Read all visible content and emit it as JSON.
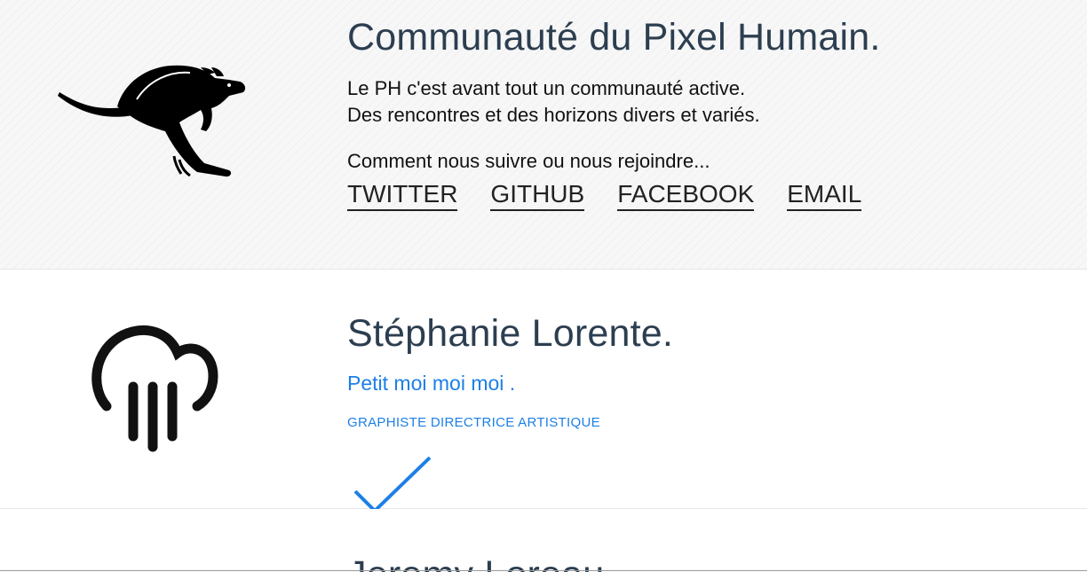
{
  "community": {
    "title": "Communauté du Pixel Humain.",
    "desc_line1": "Le PH c'est avant tout un communauté active.",
    "desc_line2": "Des rencontres et des horizons divers et variés.",
    "follow_text": "Comment nous suivre ou nous rejoindre...",
    "links": [
      "TWITTER",
      "GITHUB",
      "FACEBOOK",
      "EMAIL"
    ],
    "icon": "kangaroo-icon"
  },
  "member1": {
    "name": "Stéphanie Lorente.",
    "tagline": "Petit moi moi moi .",
    "role": "GRAPHISTE DIRECTRICE ARTISTIQUE",
    "icon": "cloud-rain-icon",
    "check_icon": "checkmark-icon"
  },
  "member2": {
    "name": "Jeremy Loreau"
  },
  "colors": {
    "accent": "#1c7fe6",
    "heading": "#2c3e50",
    "text": "#111111"
  }
}
